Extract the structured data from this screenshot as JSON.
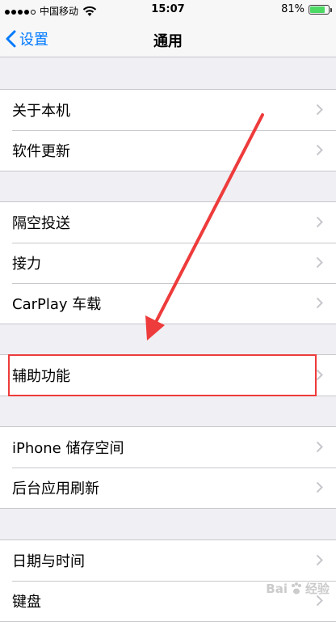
{
  "status_bar": {
    "carrier": "中国移动",
    "time": "15:07",
    "battery_percent": "81%",
    "battery_level": 0.81,
    "signal_bars": 4,
    "signal_total": 5
  },
  "nav": {
    "back_label": "设置",
    "title": "通用"
  },
  "groups": [
    {
      "items": [
        {
          "label": "关于本机"
        },
        {
          "label": "软件更新"
        }
      ]
    },
    {
      "items": [
        {
          "label": "隔空投送"
        },
        {
          "label": "接力"
        },
        {
          "label": "CarPlay 车载"
        }
      ]
    },
    {
      "items": [
        {
          "label": "辅助功能"
        }
      ]
    },
    {
      "items": [
        {
          "label": "iPhone 储存空间"
        },
        {
          "label": "后台应用刷新"
        }
      ]
    },
    {
      "items": [
        {
          "label": "日期与时间"
        },
        {
          "label": "键盘"
        }
      ]
    }
  ],
  "watermark": {
    "text_a": "Bai",
    "text_b": "经验"
  },
  "colors": {
    "accent": "#007aff",
    "annotation": "#ee3b3b",
    "battery": "#4cd964",
    "background": "#efeff4"
  }
}
